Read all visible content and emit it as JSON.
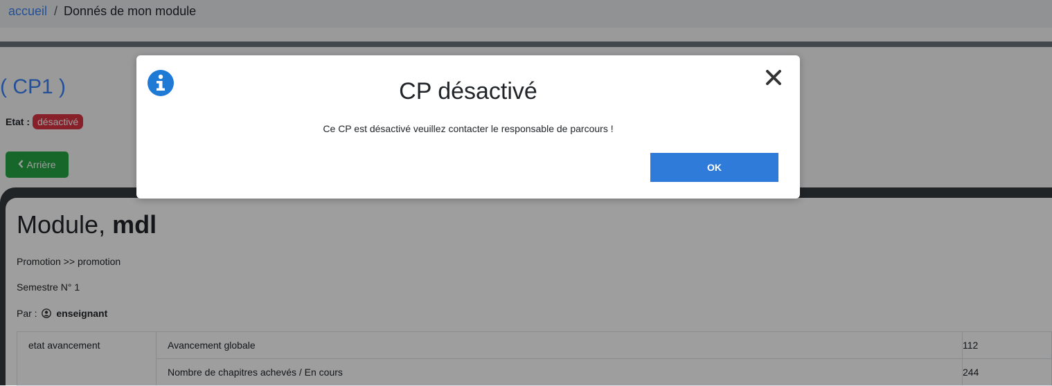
{
  "breadcrumb": {
    "home": "accueil",
    "separator": "/",
    "current": "Donnés de mon module"
  },
  "cp": {
    "title": "( CP1 )",
    "etat_label": "Etat :",
    "etat_value": "désactivé",
    "back_button": "Arrière"
  },
  "module": {
    "title_prefix": "Module,",
    "title_name": "mdl",
    "promotion": "Promotion >> promotion",
    "semestre": "Semestre N° 1",
    "par_label": "Par :",
    "teacher": "enseignant"
  },
  "stats_table": {
    "row_header": "etat avancement",
    "rows": [
      {
        "label": "Avancement globale",
        "value": "112"
      },
      {
        "label": "Nombre de chapitres achevés / En cours",
        "value": "244"
      }
    ]
  },
  "modal": {
    "title": "CP désactivé",
    "message": "Ce CP est désactivé veuillez contacter le responsable de parcours !",
    "ok_label": "OK",
    "icon": "info-circle-icon",
    "close_icon": "close-icon"
  },
  "colors": {
    "link": "#3b82f6",
    "badge_danger": "#dc3545",
    "btn_success": "#28a745",
    "btn_primary": "#2f7bd9"
  }
}
